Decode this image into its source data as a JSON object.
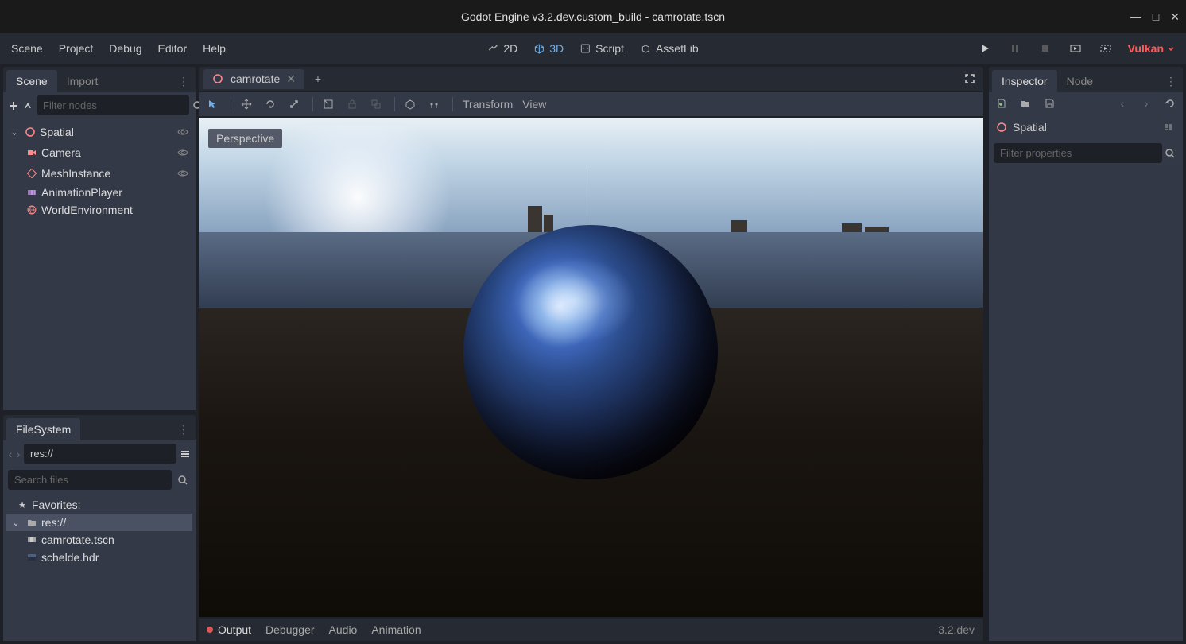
{
  "titlebar": {
    "title": "Godot Engine v3.2.dev.custom_build - camrotate.tscn"
  },
  "menubar": {
    "items": [
      "Scene",
      "Project",
      "Debug",
      "Editor",
      "Help"
    ],
    "workspaces": {
      "w2d": "2D",
      "w3d": "3D",
      "script": "Script",
      "assetlib": "AssetLib"
    },
    "renderer": "Vulkan"
  },
  "sceneDock": {
    "tabs": {
      "scene": "Scene",
      "import": "Import"
    },
    "filter_placeholder": "Filter nodes",
    "nodes": [
      {
        "name": "Spatial",
        "icon": "spatial-icon",
        "depth": 0,
        "eye": true,
        "expanded": true
      },
      {
        "name": "Camera",
        "icon": "camera-icon",
        "depth": 1,
        "eye": true
      },
      {
        "name": "MeshInstance",
        "icon": "mesh-icon",
        "depth": 1,
        "eye": true
      },
      {
        "name": "AnimationPlayer",
        "icon": "animation-icon",
        "depth": 1,
        "eye": false
      },
      {
        "name": "WorldEnvironment",
        "icon": "world-icon",
        "depth": 1,
        "eye": false
      }
    ]
  },
  "fileSystem": {
    "tab": "FileSystem",
    "path": "res://",
    "search_placeholder": "Search files",
    "items": [
      {
        "name": "Favorites:",
        "icon": "star-icon",
        "depth": 0
      },
      {
        "name": "res://",
        "icon": "folder-icon",
        "depth": 0,
        "selected": true,
        "expanded": true
      },
      {
        "name": "camrotate.tscn",
        "icon": "scene-file-icon",
        "depth": 1
      },
      {
        "name": "schelde.hdr",
        "icon": "image-file-icon",
        "depth": 1
      }
    ]
  },
  "editor": {
    "tabs": [
      {
        "name": "camrotate",
        "icon": "spatial-icon"
      }
    ],
    "toolbar": {
      "transform": "Transform",
      "view": "View"
    },
    "perspective": "Perspective"
  },
  "bottomPanel": {
    "items": {
      "output": "Output",
      "debugger": "Debugger",
      "audio": "Audio",
      "animation": "Animation"
    },
    "version": "3.2.dev"
  },
  "inspector": {
    "tabs": {
      "inspector": "Inspector",
      "node": "Node"
    },
    "node_name": "Spatial",
    "filter_placeholder": "Filter properties"
  }
}
